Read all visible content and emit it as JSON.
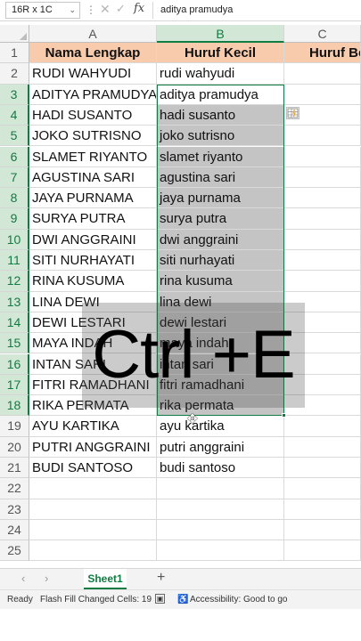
{
  "formula_bar": {
    "name_box": "16R x 1C",
    "fx_label": "fx",
    "formula": "aditya pramudya"
  },
  "columns": [
    "A",
    "B",
    "C"
  ],
  "headers": {
    "A": "Nama Lengkap",
    "B": "Huruf Kecil",
    "C": "Huruf Be"
  },
  "rows": [
    {
      "num": "1",
      "a": "",
      "b": ""
    },
    {
      "num": "2",
      "a": "RUDI WAHYUDI",
      "b": "rudi wahyudi"
    },
    {
      "num": "3",
      "a": "ADITYA PRAMUDYA",
      "b": "aditya pramudya"
    },
    {
      "num": "4",
      "a": "HADI SUSANTO",
      "b": "hadi susanto"
    },
    {
      "num": "5",
      "a": "JOKO SUTRISNO",
      "b": "joko sutrisno"
    },
    {
      "num": "6",
      "a": "SLAMET RIYANTO",
      "b": "slamet riyanto"
    },
    {
      "num": "7",
      "a": "AGUSTINA SARI",
      "b": "agustina sari"
    },
    {
      "num": "8",
      "a": "JAYA PURNAMA",
      "b": "jaya purnama"
    },
    {
      "num": "9",
      "a": "SURYA PUTRA",
      "b": "surya putra"
    },
    {
      "num": "10",
      "a": "DWI ANGGRAINI",
      "b": "dwi anggraini"
    },
    {
      "num": "11",
      "a": "SITI NURHAYATI",
      "b": "siti nurhayati"
    },
    {
      "num": "12",
      "a": "RINA KUSUMA",
      "b": "rina kusuma"
    },
    {
      "num": "13",
      "a": "LINA DEWI",
      "b": "lina dewi"
    },
    {
      "num": "14",
      "a": "DEWI LESTARI",
      "b": "dewi lestari"
    },
    {
      "num": "15",
      "a": "MAYA INDAH",
      "b": "maya indah"
    },
    {
      "num": "16",
      "a": "INTAN SARI",
      "b": "intan sari"
    },
    {
      "num": "17",
      "a": "FITRI RAMADHANI",
      "b": "fitri ramadhani"
    },
    {
      "num": "18",
      "a": "RIKA PERMATA",
      "b": "rika permata"
    },
    {
      "num": "19",
      "a": "AYU KARTIKA",
      "b": "ayu kartika"
    },
    {
      "num": "20",
      "a": "PUTRI ANGGRAINI",
      "b": "putri anggraini"
    },
    {
      "num": "21",
      "a": "BUDI SANTOSO",
      "b": "budi santoso"
    },
    {
      "num": "22",
      "a": "",
      "b": ""
    },
    {
      "num": "23",
      "a": "",
      "b": ""
    },
    {
      "num": "24",
      "a": "",
      "b": ""
    },
    {
      "num": "25",
      "a": "",
      "b": ""
    }
  ],
  "overlay_text": "Ctrl +E",
  "sheet_tab": "Sheet1",
  "status": {
    "ready": "Ready",
    "flash_fill": "Flash Fill Changed Cells: 19",
    "accessibility": "Accessibility: Good to go"
  },
  "colors": {
    "header_fill": "#f8cbad",
    "selection": "#107c41",
    "flash_fill_cells": "#c4c4c4"
  }
}
